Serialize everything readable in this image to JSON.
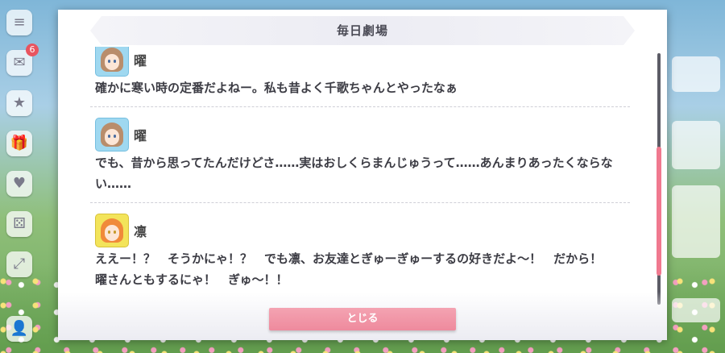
{
  "dialog": {
    "title": "毎日劇場",
    "close_label": "とじる"
  },
  "log": [
    {
      "speaker": "曜",
      "avatar": "you-avatar",
      "text": "確かに寒い時の定番だよねー。私も昔よく千歌ちゃんとやったなぁ"
    },
    {
      "speaker": "曜",
      "avatar": "you-avatar",
      "text": "でも、昔から思ってたんだけどさ……実はおしくらまんじゅうって……あんまりあったくならない……"
    },
    {
      "speaker": "凛",
      "avatar": "rin-avatar",
      "text": "ええー！？　そうかにゃ！？　でも凛、お友達とぎゅーぎゅーするの好きだよ～！　だから！　曜さんともするにゃ！　ぎゅ～！！"
    }
  ],
  "background": {
    "left_buttons": [
      "menu-icon",
      "message-icon",
      "event-icon",
      "gift-icon",
      "heart-icon",
      "dice-icon",
      "expand-icon",
      "user-icon"
    ],
    "badge_count": "6"
  },
  "colors": {
    "accent": "#ee8a9d",
    "scroll_thumb": "#f0798f",
    "title_band": "#ececf3"
  }
}
